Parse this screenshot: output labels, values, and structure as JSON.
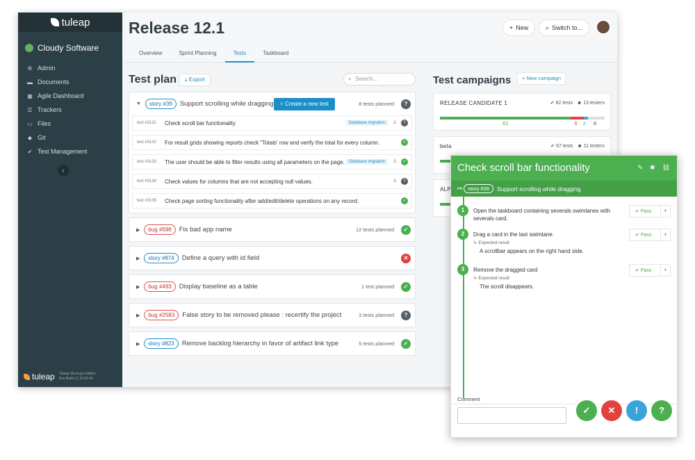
{
  "sidebar": {
    "logo": "tuleap",
    "project": "Cloudy Software",
    "items": [
      {
        "label": "Admin",
        "icon": "gear-icon"
      },
      {
        "label": "Documents",
        "icon": "folder-icon"
      },
      {
        "label": "Agile Dashboard",
        "icon": "table-icon"
      },
      {
        "label": "Trackers",
        "icon": "list-icon"
      },
      {
        "label": "Files",
        "icon": "files-icon"
      },
      {
        "label": "Git",
        "icon": "git-icon"
      },
      {
        "label": "Test Management",
        "icon": "check-icon"
      }
    ],
    "footer_logo": "tuleap",
    "footer_line1": "Tuleap Mockups Edition",
    "footer_line2": "Dev Build 11.16.99.46"
  },
  "header": {
    "title": "Release 12.1",
    "new_label": "New",
    "switch_label": "Switch to...",
    "tabs": [
      "Overview",
      "Sprint Planning",
      "Tests",
      "Taskboard"
    ]
  },
  "testplan": {
    "title": "Test plan",
    "export_label": "Export",
    "search_placeholder": "Search...",
    "create_label": "Create a new test",
    "items": [
      {
        "type": "story",
        "ref": "story #39",
        "title": "Support scrolling while dragging",
        "planned": "8 tests planned",
        "status": "unknown",
        "expanded": true,
        "tests": [
          {
            "id": "test #3131",
            "title": "Check scroll bar functionality",
            "tag": "Database migration",
            "status": "unknown"
          },
          {
            "id": "test #3132",
            "title": "For result grids showing reports check \"Totals' row and verify the total for every column.",
            "tag": "",
            "status": "pass"
          },
          {
            "id": "test #3133",
            "title": "The user should be able to filter results using all parameters on the page.",
            "tag": "Database migration",
            "status": "pass"
          },
          {
            "id": "test #3134",
            "title": "Check values for columns that are not accepting null values.",
            "tag": "",
            "status": "unknown"
          },
          {
            "id": "test #3135",
            "title": "Check page sorting functionality after add/edit/delete operations on any record.",
            "tag": "",
            "status": "pass"
          }
        ]
      },
      {
        "type": "bug",
        "ref": "bug #598",
        "title": "Fix bad app name",
        "planned": "12 tests planned",
        "status": "pass"
      },
      {
        "type": "story",
        "ref": "story #874",
        "title": "Define a query with id field",
        "planned": "",
        "status": "fail"
      },
      {
        "type": "bug",
        "ref": "bug #493",
        "title": "Display baseline as a table",
        "planned": "1 test planned",
        "status": "pass"
      },
      {
        "type": "bug",
        "ref": "bug #2583",
        "title": "False story  to be removed please : recertify the project",
        "planned": "3 tests planned",
        "status": "unknown"
      },
      {
        "type": "story",
        "ref": "story #823",
        "title": "Remove backlog hierarchy in favor of artifact link type",
        "planned": "5 tests planned",
        "status": "pass"
      }
    ]
  },
  "campaigns": {
    "title": "Test campaigns",
    "new_label": "New campaign",
    "items": [
      {
        "name": "RELEASE CANDIDATE 1",
        "tests": "82 tests",
        "testers": "13 testers",
        "passed": 62,
        "failed": 6,
        "blocked": 2,
        "notrun": 8
      },
      {
        "name": "beta",
        "tests": "67 tests",
        "testers": "11 testers"
      },
      {
        "name": "ALP"
      }
    ]
  },
  "panel": {
    "title": "Check scroll bar functionality",
    "story_ref": "story #39",
    "story_title": "Support scrolling while dragging",
    "steps": [
      {
        "num": "1",
        "text": "Open the taskboard containing severals swimlanes with severals card.",
        "expected_label": "",
        "expected": "",
        "pass": "Pass"
      },
      {
        "num": "2",
        "text": "Drag a card in the last swimlane.",
        "expected_label": "Expected result",
        "expected": "A scrollbar appears on the right hand side.",
        "pass": "Pass"
      },
      {
        "num": "3",
        "text": "Remove the dragged card",
        "expected_label": "Expected result",
        "expected": "The scroll disappears.",
        "pass": "Pass"
      }
    ],
    "comment_label": "Comment"
  },
  "colors": {
    "pass": "#4caf50",
    "fail": "#e0433d",
    "blocked": "#3aa3d9",
    "unknown": "#555f66",
    "accent": "#1a8fc8",
    "sidebar": "#2c3e46"
  }
}
